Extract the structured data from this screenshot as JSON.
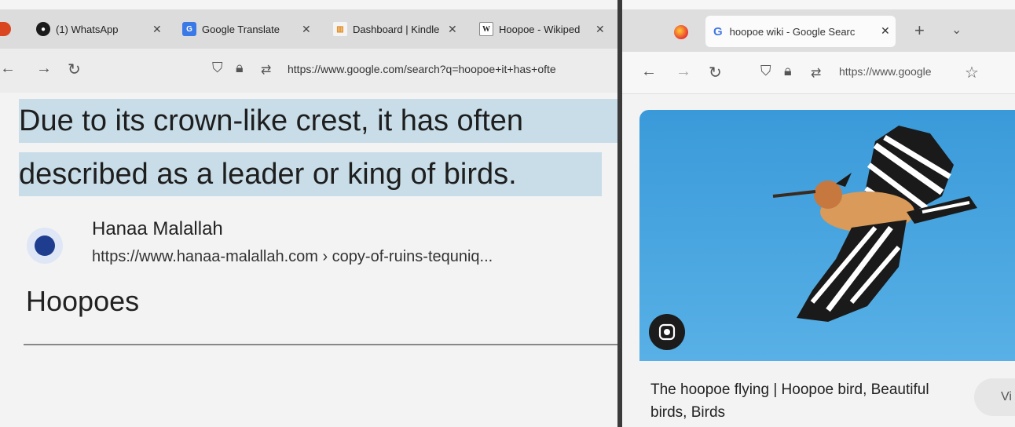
{
  "left_window": {
    "tabs": [
      {
        "label": "(1) WhatsApp",
        "icon": "whatsapp-icon"
      },
      {
        "label": "Google Translate",
        "icon": "translate-icon"
      },
      {
        "label": "Dashboard | Kindle",
        "icon": "dashboard-icon"
      },
      {
        "label": "Hoopoe - Wikiped",
        "icon": "wikipedia-icon"
      }
    ],
    "url": "https://www.google.com/search?q=hoopoe+it+has+ofte",
    "highlight_line1": "Due to its crown-like crest, it has often",
    "highlight_line2": "described as a leader or king of birds.",
    "result": {
      "site_name": "Hanaa Malallah",
      "site_url": "https://www.hanaa-malallah.com › copy-of-ruins-tequniq...",
      "title": "Hoopoes"
    }
  },
  "right_window": {
    "tab_label": "hoopoe wiki - Google Searc",
    "url": "https://www.google",
    "image_caption": "The hoopoe flying | Hoopoe bird, Beautiful birds, Birds",
    "visit_label": "Vi"
  },
  "colors": {
    "highlight": "#c8dde8",
    "sky": "#4aa6df",
    "accent_blue": "#1e3d8f"
  }
}
